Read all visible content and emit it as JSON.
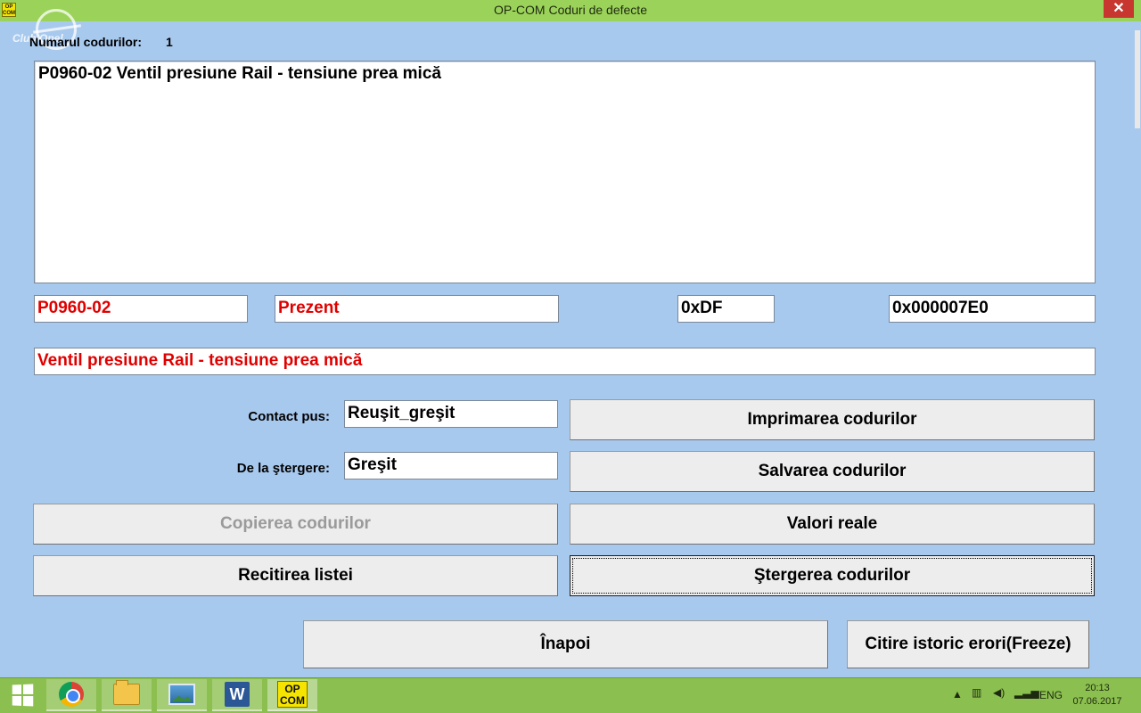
{
  "window": {
    "title": "OP-COM   Coduri de defecte",
    "icon_text": "OP COM",
    "close_label": "✕"
  },
  "watermark": {
    "text": "Club Opel"
  },
  "summary": {
    "count_label": "Numarul codurilor:",
    "count_value": "1"
  },
  "codes_list": {
    "items": [
      "P0960-02 Ventil presiune Rail - tensiune prea mică"
    ]
  },
  "detail": {
    "code": "P0960-02",
    "status": "Prezent",
    "hex1": "0xDF",
    "hex2": "0x000007E0",
    "description": "Ventil presiune Rail - tensiune prea mică"
  },
  "contact": {
    "label": "Contact pus:",
    "value": "Reuşit_greşit"
  },
  "since_clear": {
    "label": "De la ştergere:",
    "value": "Greşit"
  },
  "buttons": {
    "print": "Imprimarea codurilor",
    "save": "Salvarea codurilor",
    "copy": "Copierea codurilor",
    "real_values": "Valori reale",
    "reread": "Recitirea listei",
    "clear": "Ştergerea codurilor",
    "back": "Înapoi",
    "freeze": "Citire istoric erori(Freeze)"
  },
  "taskbar": {
    "word_letter": "W",
    "opcom_text": "OP COM",
    "language": "ENG",
    "time": "20:13",
    "date": "07.06.2017"
  },
  "colors": {
    "background": "#a8c9ee",
    "titlebar": "#9bd35a",
    "taskbar": "#8bbf4f",
    "alert_text": "#e00000"
  },
  "icons": {
    "start": "windows-start-icon",
    "browser": "chrome-icon",
    "explorer": "folder-icon",
    "photos": "photo-viewer-icon",
    "word": "word-icon",
    "opcom": "opcom-icon",
    "tray": [
      "show-hidden-icons-arrow",
      "network-icon",
      "volume-icon",
      "signal-icon"
    ]
  }
}
